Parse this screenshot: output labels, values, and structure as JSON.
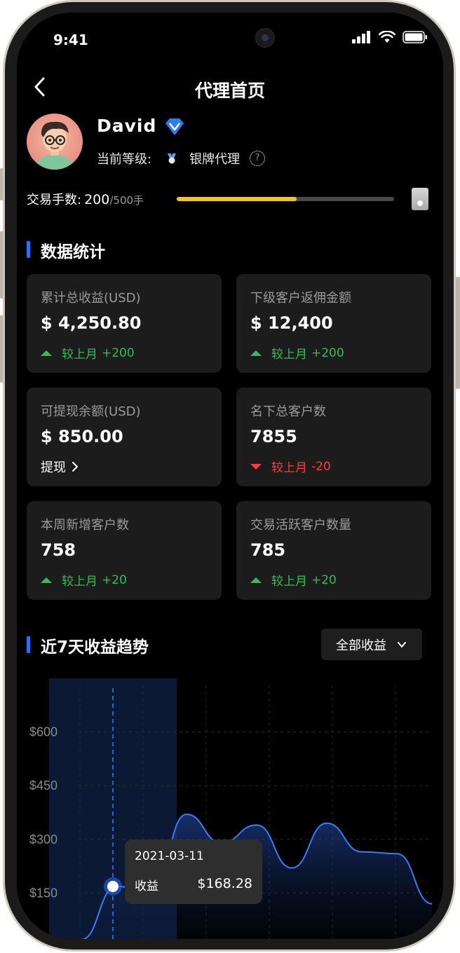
{
  "status_bar": {
    "time": "9:41"
  },
  "header": {
    "title": "代理首页"
  },
  "profile": {
    "name": "David",
    "level_label": "当前等级:",
    "level_value": "银牌代理",
    "help": "?"
  },
  "trade": {
    "label": "交易手数:",
    "value": "200",
    "max": "/500手",
    "progress": 0.55
  },
  "stats": {
    "title": "数据统计",
    "cards": [
      {
        "label": "累计总收益(USD)",
        "value": "$ 4,250.80",
        "trend_label": "较上月",
        "trend_value": "+200",
        "trend_dir": "up"
      },
      {
        "label": "下级客户返佣金额",
        "value": "$ 12,400",
        "trend_label": "较上月",
        "trend_value": "+200",
        "trend_dir": "up"
      },
      {
        "label": "可提现余额(USD)",
        "value": "$ 850.00",
        "link": "提现"
      },
      {
        "label": "名下总客户数",
        "value": "7855",
        "trend_label": "较上月",
        "trend_value": "-20",
        "trend_dir": "down"
      },
      {
        "label": "本周新增客户数",
        "value": "758",
        "trend_label": "较上月",
        "trend_value": "+20",
        "trend_dir": "up"
      },
      {
        "label": "交易活跃客户数量",
        "value": "785",
        "trend_label": "较上月",
        "trend_value": "+20",
        "trend_dir": "up"
      }
    ]
  },
  "trend_section": {
    "title": "近7天收益趋势",
    "filter": "全部收益"
  },
  "tooltip": {
    "date": "2021-03-11",
    "label": "收益",
    "value": "$168.28"
  },
  "colors": {
    "accent": "#2f6bff",
    "up": "#2fbf56",
    "down": "#ff3b3b",
    "progress": "#f5c518"
  },
  "chart_data": {
    "type": "area",
    "y_ticks": [
      "$600",
      "$450",
      "$300",
      "$150"
    ],
    "ylim": [
      0,
      650
    ],
    "highlighted_point": {
      "date": "2021-03-11",
      "value": 168.28
    },
    "series": [
      {
        "values": [
          20,
          168.28,
          155,
          370,
          290,
          340,
          220,
          345,
          265,
          260,
          120
        ]
      }
    ]
  }
}
